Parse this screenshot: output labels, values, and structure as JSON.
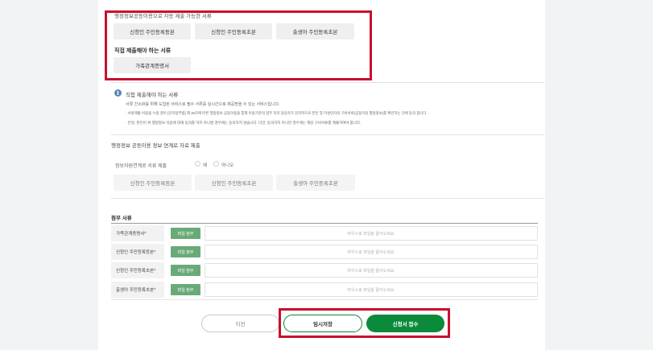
{
  "available_docs": {
    "section_title": "행정정보공동이용으로 자동 제출 가능한 서류",
    "items": [
      "신청인 주민등록등본",
      "신청인 주민등록초본",
      "출생아 주민등록초본"
    ]
  },
  "direct_docs": {
    "section_title": "직접 제출해야 하는 서류",
    "items": [
      "가족관계증명서"
    ]
  },
  "info": {
    "title": "직접 제출해야 하는 서류",
    "lines": [
      "서류 간소화를 위해 도입된 서비스로 필수 서류를 실시간으로 제공받을 수 있는 서비스입니다.",
      "· 서류제출 비용을 누릴 경우 [전자정부법] 제 36조에 따른 행정정보 공동이용을 통해 이용기관의 업무 처리 담당자가 전자적으로 본인 및 미성년자의 구비서류(공동이용 행정정보)를 확인하는 것에 동의 합니다.",
      "· 만일, 본인이 위 행정정보 이용에 대해 동의를 하지 아니할 경우에는 동의하지 않습니다. 다만, 동의하지 아니한 경우에는 해당 구비서류를 제출하여야 합니다."
    ]
  },
  "sharing": {
    "heading": "행정정보 공동이용 정보 연계로 자료 제출",
    "question": "정보자원연계로 서류 제출",
    "option_yes": "예",
    "option_no": "아니오",
    "docs": [
      "신청인 주민등록등본",
      "신청인 주민등록초본",
      "출생아 주민등록초본"
    ]
  },
  "attachments": {
    "heading": "첨부 서류",
    "button_label": "파일 첨부",
    "placeholder": "마우스로 파일을 끌어오세요.",
    "rows": [
      {
        "label": "가족관계증명서*"
      },
      {
        "label": "신청인 주민등록등본*"
      },
      {
        "label": "신청인 주민등록초본*"
      },
      {
        "label": "출생아 주민등록초본*"
      }
    ]
  },
  "actions": {
    "prev": "이전",
    "save": "임시저장",
    "submit": "신청서 접수"
  },
  "colors": {
    "highlight": "#c8102e",
    "primary_green": "#0a8a3a",
    "attach_green": "#6aaa78",
    "info_blue": "#5b87b7"
  }
}
